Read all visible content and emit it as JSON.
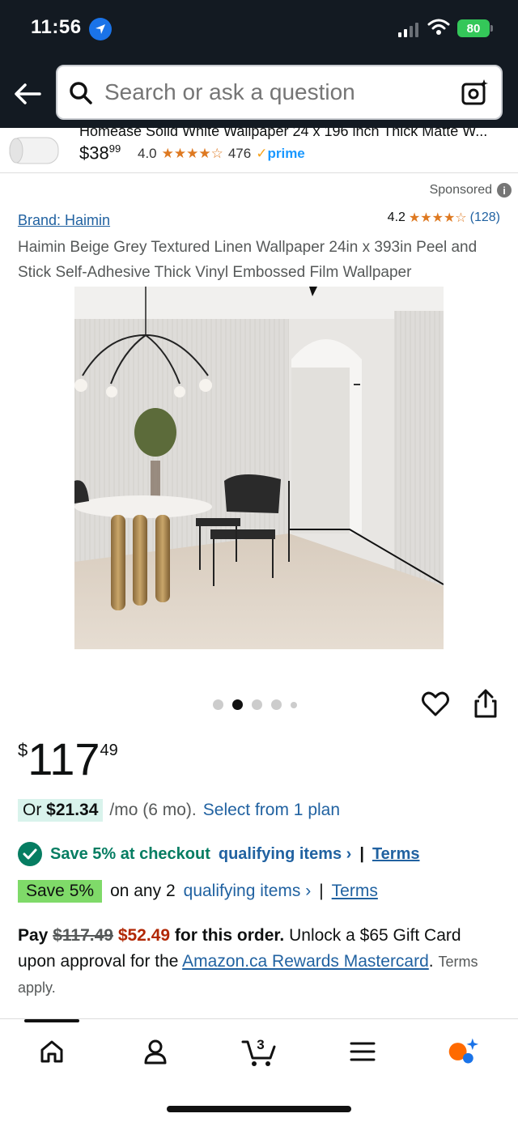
{
  "status_bar": {
    "time": "11:56",
    "battery": "80"
  },
  "header": {
    "search_placeholder": "Search or ask a question"
  },
  "sticky_product": {
    "title": "Homease Solid White Wallpaper 24 x 196 inch Thick Matte W...",
    "price_whole": "$38",
    "price_fraction": "99",
    "rating": "4.0",
    "stars": "★★★★☆",
    "review_count": "476",
    "prime_label": "prime"
  },
  "listing": {
    "sponsored_label": "Sponsored",
    "brand_label": "Brand: Haimin",
    "rating": "4.2",
    "stars": "★★★★☆",
    "review_count": "(128)",
    "title": "Haimin Beige Grey Textured Linen Wallpaper 24in x 393in Peel and Stick Self-Adhesive Thick Vinyl Embossed Film Wallpaper",
    "image_count": 5,
    "active_image_index": 2
  },
  "price": {
    "symbol": "$",
    "whole": "117",
    "fraction": "49"
  },
  "installment": {
    "prefix": "Or",
    "amount": "$21.34",
    "term": "/mo (6 mo).",
    "link": "Select from 1 plan"
  },
  "promo1": {
    "text": "Save 5% at checkout",
    "link": "qualifying items ›",
    "separator": "|",
    "terms": "Terms"
  },
  "promo2": {
    "badge": "Save 5%",
    "text": "on any 2",
    "link": "qualifying items ›",
    "separator": "|",
    "terms": "Terms"
  },
  "card_offer": {
    "pay": "Pay",
    "old_price": "$117.49",
    "new_price": "$52.49",
    "for_order": "for this order.",
    "unlock": "Unlock a $65 Gift Card upon approval for the",
    "card_link": "Amazon.ca Rewards Mastercard",
    "terms": "Terms apply."
  },
  "bottom_nav": {
    "cart_count": "3"
  },
  "colors": {
    "header_bg": "#131a22",
    "link": "#2162a1",
    "star": "#de7921",
    "deal_red": "#b12704",
    "green": "#067d62",
    "badge_green": "#7fda69"
  }
}
